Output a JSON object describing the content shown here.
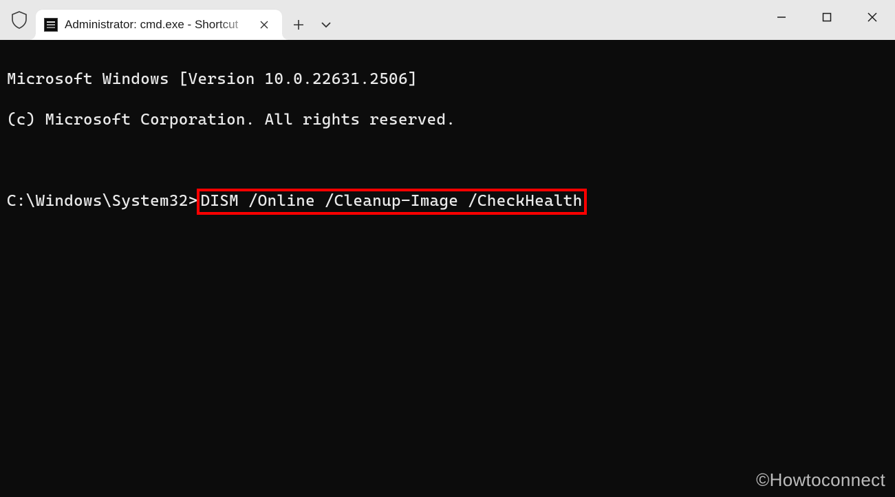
{
  "titlebar": {
    "tab": {
      "title": "Administrator: cmd.exe - Shortcut"
    }
  },
  "terminal": {
    "line1": "Microsoft Windows [Version 10.0.22631.2506]",
    "line2": "(c) Microsoft Corporation. All rights reserved.",
    "prompt": "C:\\Windows\\System32>",
    "command": "DISM /Online /Cleanup-Image /CheckHealth"
  },
  "watermark": "©Howtoconnect"
}
